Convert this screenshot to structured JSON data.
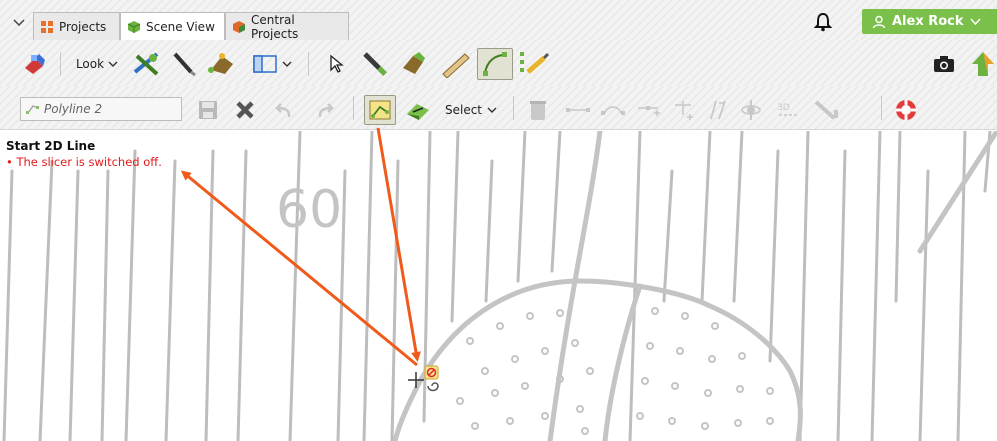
{
  "tabs": [
    {
      "label": "Projects",
      "icon": "grid-icon"
    },
    {
      "label": "Scene View",
      "icon": "cube-icon",
      "active": true
    },
    {
      "label": "Central Projects",
      "icon": "cube-orange-icon"
    }
  ],
  "user": {
    "name": "Alex Rock"
  },
  "toolbar1": {
    "look_label": "Look"
  },
  "toolbar2": {
    "polyline_placeholder": "Polyline 2",
    "select_label": "Select"
  },
  "hint": {
    "title": "Start 2D Line",
    "message": "• The slicer is switched off."
  },
  "map": {
    "contour_label": "60"
  },
  "colors": {
    "user_button": "#7bc04b",
    "annotation_arrow": "#f05a1a",
    "error_text": "#e01b1b"
  }
}
